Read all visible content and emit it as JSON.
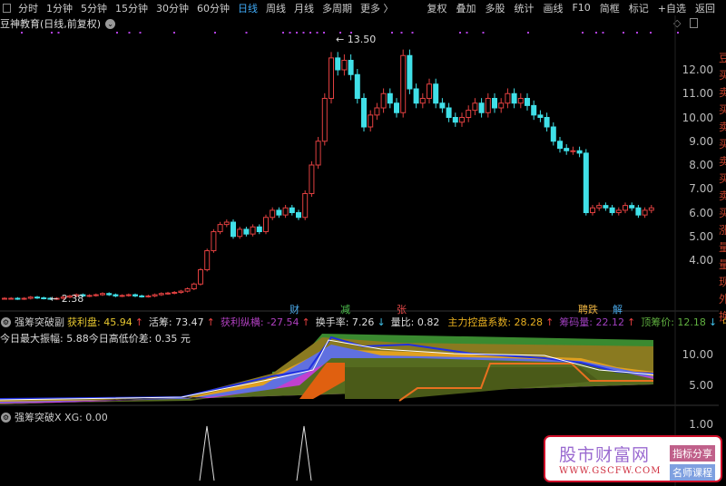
{
  "topbar": {
    "periods": [
      "分时",
      "1分钟",
      "5分钟",
      "15分钟",
      "30分钟",
      "60分钟",
      "日线",
      "周线",
      "月线",
      "多周期",
      "更多 〉"
    ],
    "active": "日线",
    "actions": [
      "复权",
      "叠加",
      "多股",
      "统计",
      "画线",
      "F10",
      "简框",
      "标记",
      "+自选",
      "返回"
    ]
  },
  "stock": {
    "title": "豆神教育(日线,前复权)"
  },
  "price_axis": [
    "12.00",
    "11.00",
    "10.00",
    "9.00",
    "8.00",
    "7.00",
    "6.00",
    "5.00",
    "4.00"
  ],
  "right_side_chars": [
    "豆",
    "买",
    "卖",
    "买",
    "卖",
    "买",
    "卖",
    "买",
    "卖",
    "买",
    "涨",
    "量",
    "量",
    "现",
    "外",
    "换"
  ],
  "annotations": {
    "high": "13.50",
    "low": "2.38"
  },
  "events": [
    {
      "label": "财",
      "color": "#4aa8e8"
    },
    {
      "label": "减",
      "color": "#4ec04e"
    },
    {
      "label": "张",
      "color": "#e84a4a"
    },
    {
      "label": "聘跌",
      "color": "#e8b040"
    },
    {
      "label": "解",
      "color": "#4aa8e8"
    }
  ],
  "indicator1": {
    "name": "强筹突破副",
    "items": [
      {
        "label": "获利盘: 45.94",
        "arrow": "↑",
        "color": "#e8c830",
        "arrow_color": "#e84040"
      },
      {
        "label": "活筹: 73.47",
        "arrow": "↑",
        "color": "#dddddd",
        "arrow_color": "#e84040"
      },
      {
        "label": "获利纵横: -27.54",
        "arrow": "↑",
        "color": "#b040c0",
        "arrow_color": "#e84040"
      },
      {
        "label": "换手率: 7.26",
        "arrow": "↓",
        "color": "#dddddd",
        "arrow_color": "#40c0e8"
      },
      {
        "label": "量比: 0.82",
        "arrow": "",
        "color": "#dddddd",
        "arrow_color": "#dddddd"
      },
      {
        "label": "主力控盘系数: 28.28",
        "arrow": "↑",
        "color": "#e8b020",
        "arrow_color": "#e84040"
      },
      {
        "label": "筹码量: 22.12",
        "arrow": "↑",
        "color": "#a040c0",
        "arrow_color": "#e84040"
      },
      {
        "label": "顶筹价: 12.18",
        "arrow": "↓",
        "color": "#60b040",
        "arrow_color": "#40c0e8"
      },
      {
        "label": "中筹价:",
        "arrow": "",
        "color": "#e8b020",
        "arrow_color": "#e8b020"
      }
    ],
    "line2": "今日最大振幅: 5.88今日高低价差: 0.35 元",
    "axis": [
      "10.00",
      "5.00"
    ]
  },
  "indicator2": {
    "name": "强筹突破X",
    "value": "XG: 0.00",
    "axis": [
      "1.00"
    ]
  },
  "watermark": {
    "title": "股市财富网",
    "url": "WWW.GSCFW.COM",
    "tag1": "指标分享",
    "tag2": "名师课程"
  },
  "chart_data": {
    "type": "candlestick",
    "ylim": [
      2,
      14
    ],
    "closes": [
      2.4,
      2.4,
      2.38,
      2.4,
      2.45,
      2.42,
      2.4,
      2.38,
      2.4,
      2.45,
      2.5,
      2.55,
      2.5,
      2.52,
      2.55,
      2.6,
      2.55,
      2.5,
      2.52,
      2.55,
      2.5,
      2.48,
      2.5,
      2.55,
      2.6,
      2.62,
      2.65,
      2.7,
      2.8,
      3.0,
      3.6,
      4.4,
      5.2,
      5.5,
      5.6,
      5.0,
      5.3,
      5.1,
      5.4,
      5.2,
      5.8,
      6.1,
      5.9,
      6.2,
      6.0,
      5.8,
      6.8,
      8.0,
      9.0,
      10.8,
      12.5,
      12.0,
      12.4,
      11.8,
      10.8,
      9.6,
      10.1,
      10.4,
      11.0,
      10.6,
      10.2,
      12.6,
      11.2,
      10.6,
      10.8,
      11.4,
      10.6,
      10.4,
      10.0,
      9.8,
      10.0,
      10.3,
      10.6,
      10.2,
      10.8,
      10.4,
      10.6,
      11.0,
      10.6,
      10.8,
      10.5,
      10.1,
      10.0,
      9.6,
      9.0,
      8.7,
      8.6,
      8.6,
      8.5,
      6.0,
      6.2,
      6.3,
      6.2,
      6.0,
      6.1,
      6.3,
      6.2,
      5.9,
      6.1,
      6.2
    ],
    "up_color": "#e04040",
    "down_color": "#40e0e8",
    "xg_signals": [
      31,
      46
    ]
  }
}
